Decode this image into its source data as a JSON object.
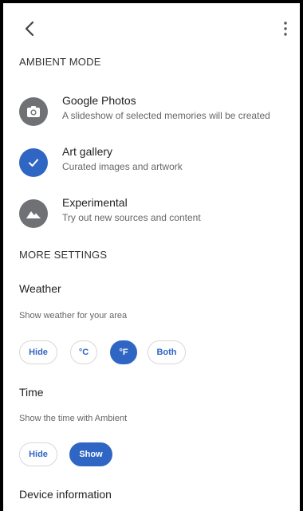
{
  "header": {
    "back_icon": "back-arrow-icon",
    "more_icon": "more-vert-icon"
  },
  "ambient": {
    "title": "AMBIENT MODE",
    "options": [
      {
        "title": "Google Photos",
        "desc": "A slideshow of selected memories will be created",
        "icon": "camera-icon",
        "selected": false
      },
      {
        "title": "Art gallery",
        "desc": "Curated images and artwork",
        "icon": "check-icon",
        "selected": true
      },
      {
        "title": "Experimental",
        "desc": "Try out new sources and content",
        "icon": "landscape-icon",
        "selected": false
      }
    ]
  },
  "more_settings": {
    "title": "MORE SETTINGS",
    "weather": {
      "title": "Weather",
      "desc": "Show weather for your area",
      "chips": [
        "Hide",
        "°C",
        "°F",
        "Both"
      ],
      "selected": "°F"
    },
    "time": {
      "title": "Time",
      "desc": "Show the time with Ambient",
      "chips": [
        "Hide",
        "Show"
      ],
      "selected": "Show"
    },
    "device_info": {
      "title": "Device information"
    }
  },
  "colors": {
    "accent": "#2f66c4",
    "icon_gray": "#6f7175"
  }
}
